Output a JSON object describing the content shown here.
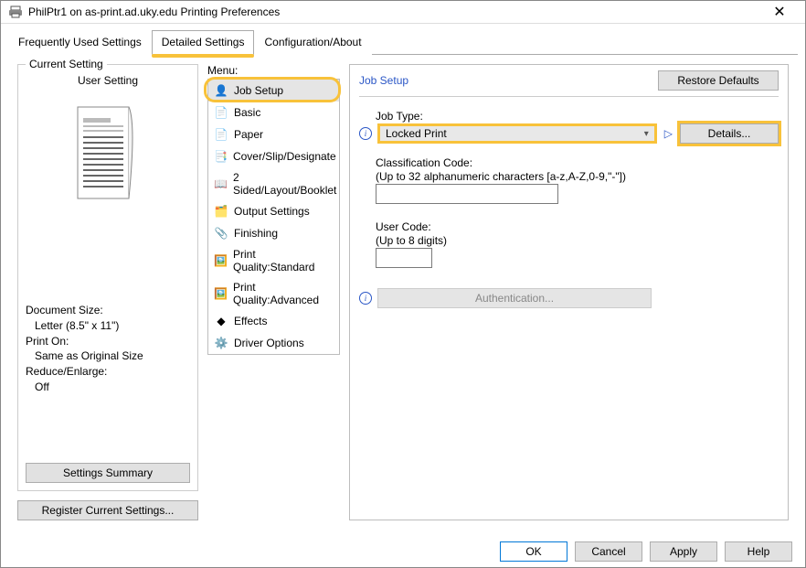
{
  "window": {
    "title": "PhilPtr1 on as-print.ad.uky.edu Printing Preferences"
  },
  "tabs": {
    "frequently": "Frequently Used Settings",
    "detailed": "Detailed Settings",
    "config": "Configuration/About"
  },
  "current_setting": {
    "legend": "Current Setting",
    "label": "User Setting",
    "doc_size_label": "Document Size:",
    "doc_size_value": "Letter (8.5\" x 11\")",
    "print_on_label": "Print On:",
    "print_on_value": "Same as Original Size",
    "reduce_label": "Reduce/Enlarge:",
    "reduce_value": "Off",
    "summary_btn": "Settings Summary"
  },
  "register_btn": "Register Current Settings...",
  "menu": {
    "label": "Menu:",
    "items": [
      "Job Setup",
      "Basic",
      "Paper",
      "Cover/Slip/Designate",
      "2 Sided/Layout/Booklet",
      "Output Settings",
      "Finishing",
      "Print Quality:Standard",
      "Print Quality:Advanced",
      "Effects",
      "Driver Options"
    ]
  },
  "right": {
    "header": "Job Setup",
    "restore": "Restore Defaults",
    "job_type_label": "Job Type:",
    "job_type_value": "Locked Print",
    "details_btn": "Details...",
    "classification_label": "Classification Code:",
    "classification_hint": "(Up to 32 alphanumeric characters [a-z,A-Z,0-9,\"-\"])",
    "classification_value": "",
    "user_code_label": "User Code:",
    "user_code_hint": "(Up to 8 digits)",
    "user_code_value": "",
    "auth_btn": "Authentication..."
  },
  "footer": {
    "ok": "OK",
    "cancel": "Cancel",
    "apply": "Apply",
    "help": "Help"
  }
}
